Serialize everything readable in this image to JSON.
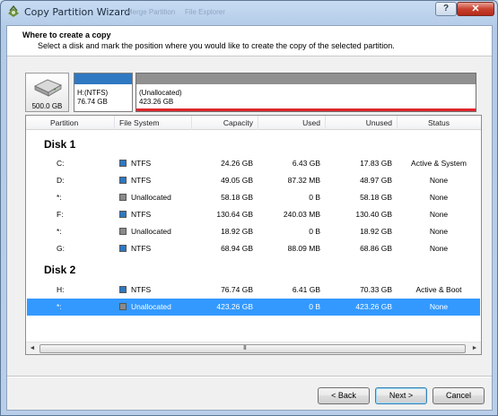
{
  "window": {
    "title": "Copy Partition Wizard",
    "ghost_text": [
      "Merge Partition",
      "File Explorer"
    ],
    "help_label": "?",
    "close_label": "✕"
  },
  "header": {
    "title": "Where to create a copy",
    "subtitle": "Select a disk and mark the position where you would like to create the copy of the selected partition."
  },
  "disk_map": {
    "disk_icon": "hard-disk-icon",
    "disk_size": "500.0 GB",
    "partitions": [
      {
        "line1": "H:(NTFS)",
        "line2": "76.74 GB",
        "bar_color": "#2f78c2",
        "selected": false
      },
      {
        "line1": "(Unallocated)",
        "line2": "423.26 GB",
        "bar_color": "#909090",
        "selected": true,
        "selected_color": "#e0262b"
      }
    ]
  },
  "table": {
    "columns": [
      "Partition",
      "File System",
      "Capacity",
      "Used",
      "Unused",
      "Status"
    ],
    "disks": [
      {
        "title": "Disk 1",
        "rows": [
          {
            "partition": "C:",
            "fs": "NTFS",
            "swatch": "#2f78c2",
            "capacity": "24.26 GB",
            "used": "6.43 GB",
            "unused": "17.83 GB",
            "status": "Active & System"
          },
          {
            "partition": "D:",
            "fs": "NTFS",
            "swatch": "#2f78c2",
            "capacity": "49.05 GB",
            "used": "87.32 MB",
            "unused": "48.97 GB",
            "status": "None"
          },
          {
            "partition": "*:",
            "fs": "Unallocated",
            "swatch": "#8a8a8a",
            "capacity": "58.18 GB",
            "used": "0 B",
            "unused": "58.18 GB",
            "status": "None"
          },
          {
            "partition": "F:",
            "fs": "NTFS",
            "swatch": "#2f78c2",
            "capacity": "130.64 GB",
            "used": "240.03 MB",
            "unused": "130.40 GB",
            "status": "None"
          },
          {
            "partition": "*:",
            "fs": "Unallocated",
            "swatch": "#8a8a8a",
            "capacity": "18.92 GB",
            "used": "0 B",
            "unused": "18.92 GB",
            "status": "None"
          },
          {
            "partition": "G:",
            "fs": "NTFS",
            "swatch": "#2f78c2",
            "capacity": "68.94 GB",
            "used": "88.09 MB",
            "unused": "68.86 GB",
            "status": "None"
          }
        ]
      },
      {
        "title": "Disk 2",
        "rows": [
          {
            "partition": "H:",
            "fs": "NTFS",
            "swatch": "#2f78c2",
            "capacity": "76.74 GB",
            "used": "6.41 GB",
            "unused": "70.33 GB",
            "status": "Active & Boot"
          },
          {
            "partition": "*:",
            "fs": "Unallocated",
            "swatch": "#8a8a8a",
            "capacity": "423.26 GB",
            "used": "0 B",
            "unused": "423.26 GB",
            "status": "None",
            "selected": true
          }
        ]
      }
    ],
    "scrollbar": {
      "left_arrow": "◄",
      "right_arrow": "►",
      "grip": "III"
    }
  },
  "buttons": {
    "back": "< Back",
    "next": "Next >",
    "cancel": "Cancel"
  }
}
